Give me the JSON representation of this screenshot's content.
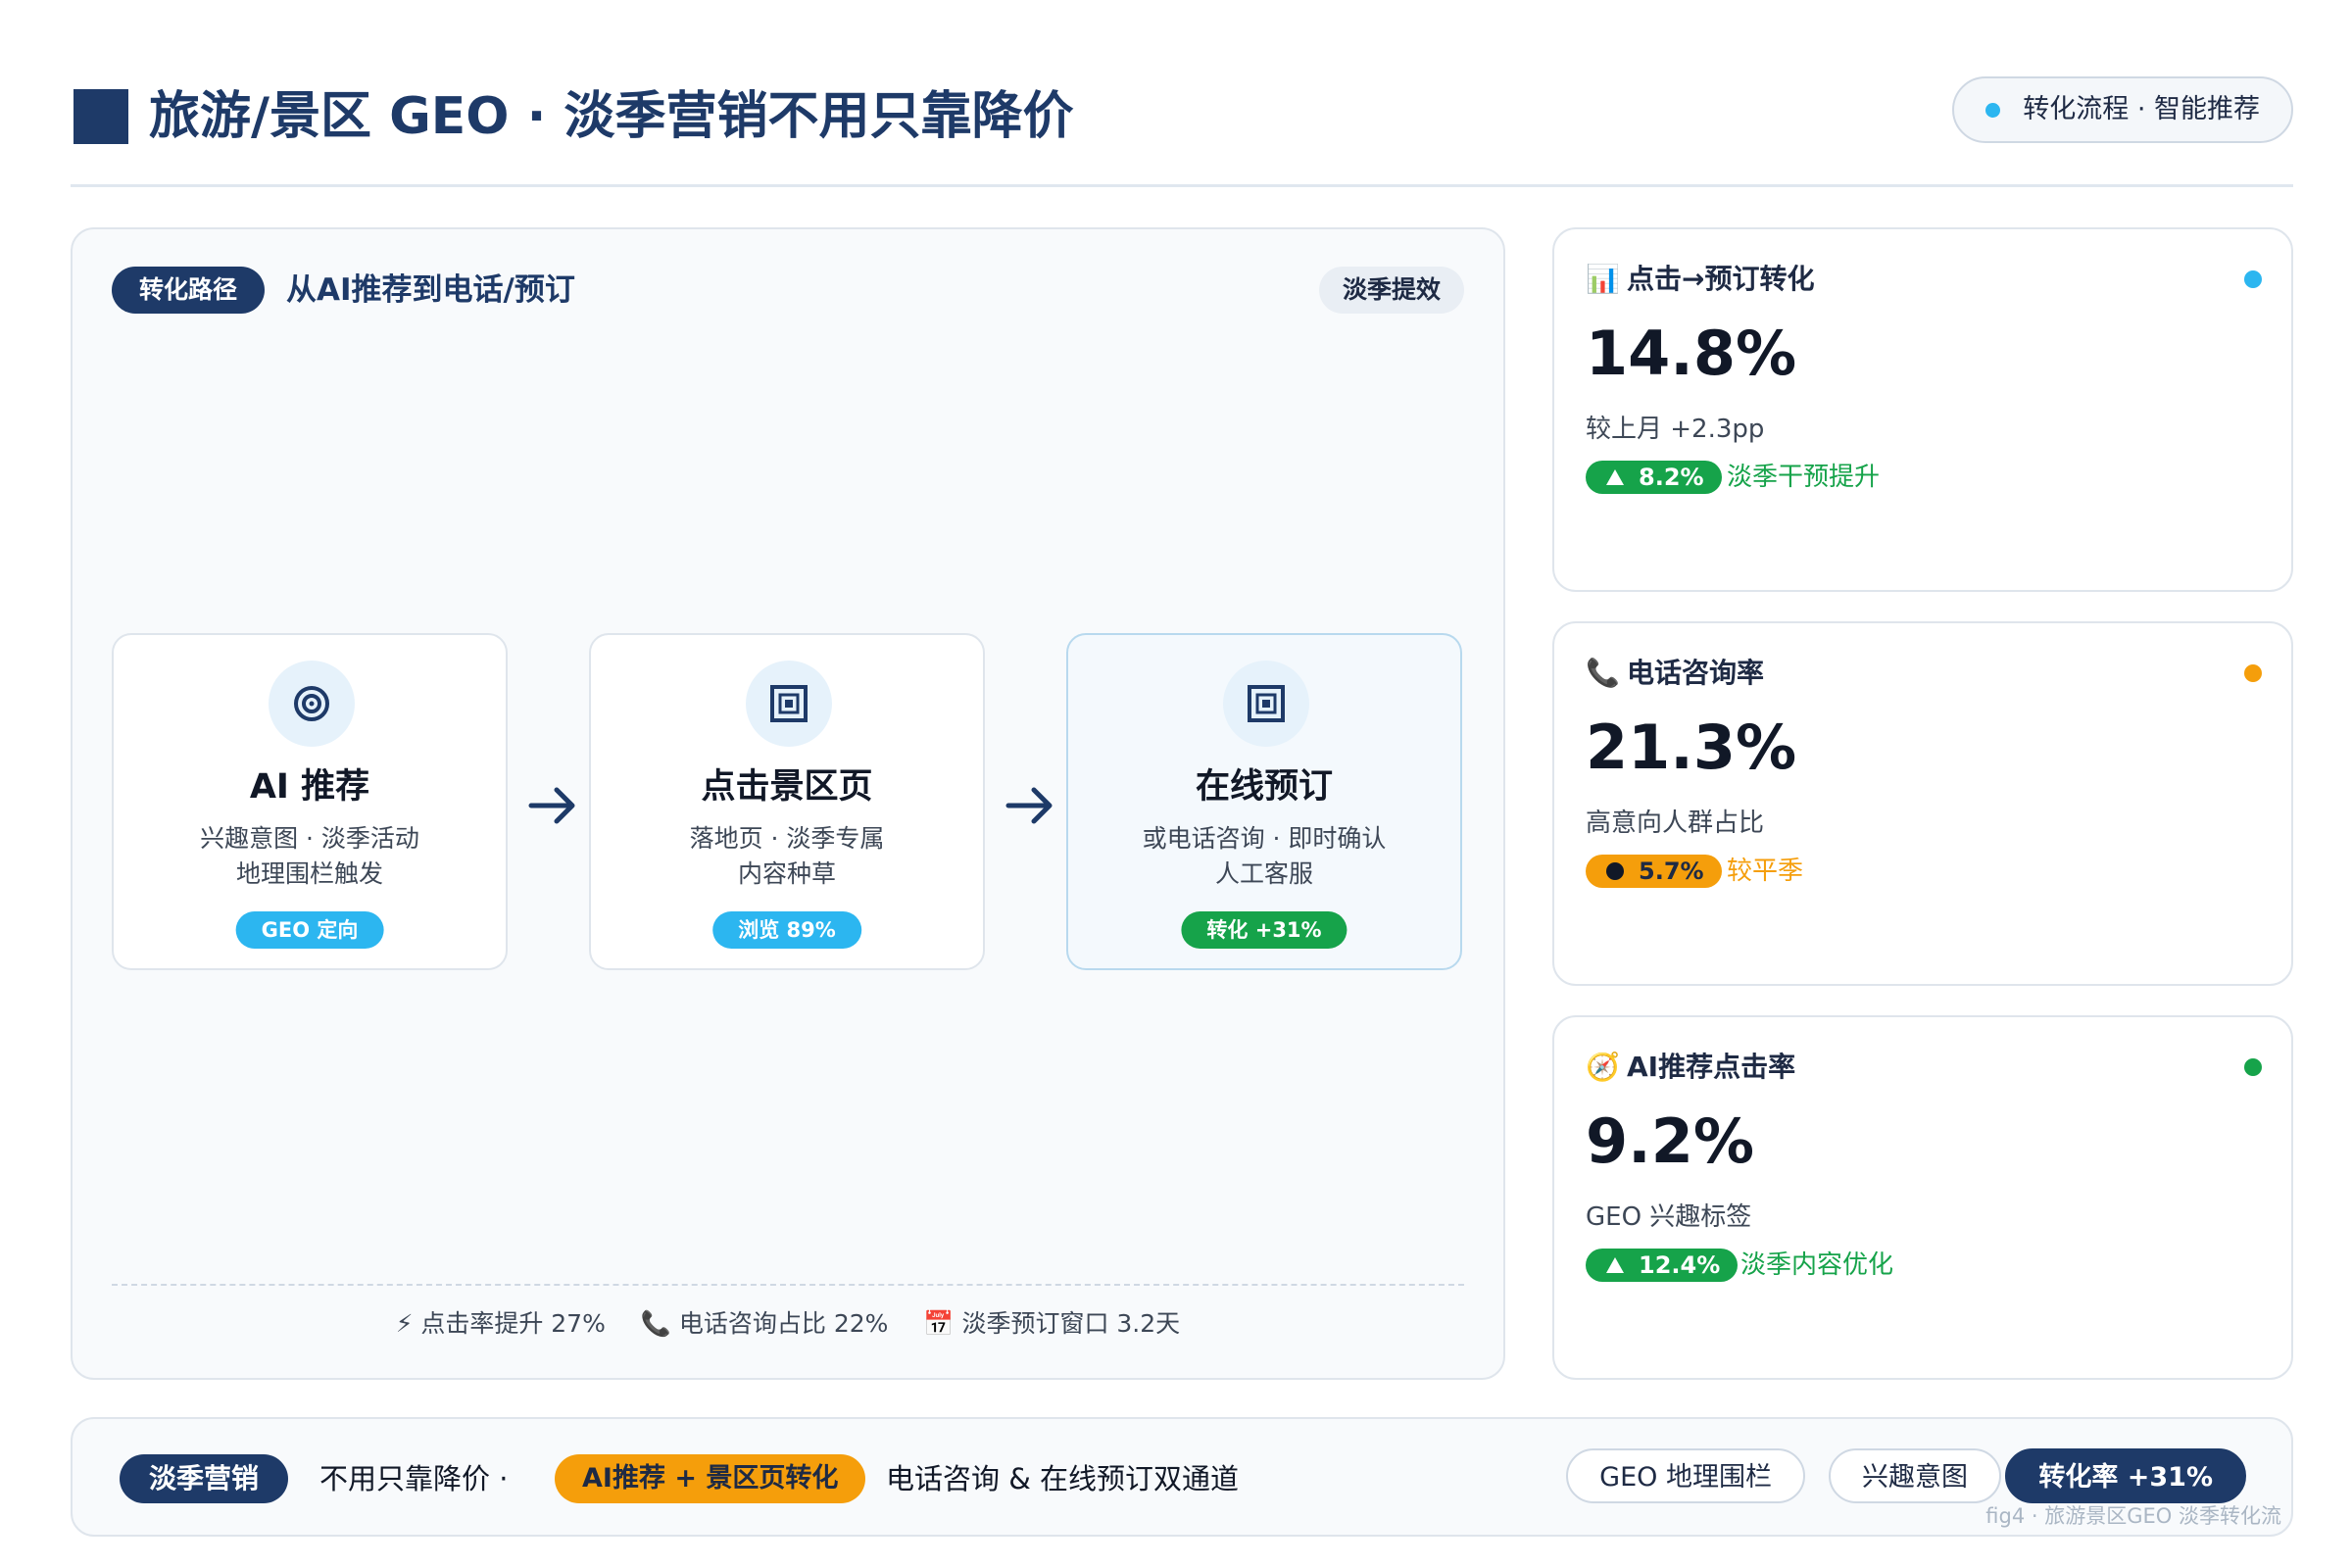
{
  "header": {
    "title": "旅游/景区 GEO · 淡季营销不用只靠降价",
    "pill_text": "转化流程 · 智能推荐"
  },
  "flow": {
    "route_badge": "转化路径",
    "route_title": "从AI推荐到电话/预订",
    "offseason_label": "淡季提效",
    "steps": [
      {
        "title": "AI 推荐",
        "desc1": "兴趣意图 · 淡季活动",
        "desc2": "地理围栏触发",
        "badge": "GEO 定向",
        "icon": "target-icon"
      },
      {
        "title": "点击景区页",
        "desc1": "落地页 · 淡季专属",
        "desc2": "内容种草",
        "badge": "浏览 89%",
        "icon": "page-icon"
      },
      {
        "title": "在线预订",
        "desc1": "或电话咨询 · 即时确认",
        "desc2": "人工客服",
        "badge": "转化 +31%",
        "icon": "booking-icon"
      }
    ],
    "footer": [
      {
        "icon": "⚡",
        "text": "点击率提升 27%"
      },
      {
        "icon": "📞",
        "text": "电话咨询占比 22%"
      },
      {
        "icon": "📅",
        "text": "淡季预订窗口 3.2天"
      }
    ]
  },
  "kpis": [
    {
      "icon": "📊",
      "label": "点击→预订转化",
      "value": "14.8%",
      "sub": "较上月 +2.3pp",
      "chip": "8.2%",
      "chip_glyph": "up-triangle",
      "note": "淡季干预提升",
      "dot_color": "#2cb6f0",
      "chip_color": "#16a34a",
      "note_color": "#16a34a"
    },
    {
      "icon": "📞",
      "label": "电话咨询率",
      "value": "21.3%",
      "sub": "高意向人群占比",
      "chip": "5.7%",
      "chip_glyph": "dot",
      "note": "较平季",
      "dot_color": "#f59e0b",
      "chip_color": "#f59e0b",
      "note_color": "#f59e0b"
    },
    {
      "icon": "🧭",
      "label": "AI推荐点击率",
      "value": "9.2%",
      "sub": "GEO 兴趣标签",
      "chip": "12.4%",
      "chip_glyph": "up-triangle",
      "note": "淡季内容优化",
      "dot_color": "#16a34a",
      "chip_color": "#16a34a",
      "note_color": "#16a34a"
    }
  ],
  "bottom": {
    "badge": "淡季营销",
    "text1": "不用只靠降价 ·",
    "highlight": "AI推荐 + 景区页转化",
    "text2": "电话咨询 & 在线预订双通道",
    "pills": [
      "GEO 地理围栏",
      "兴趣意图",
      "转化率 +31%"
    ],
    "watermark": "fig4 · 旅游景区GEO 淡季转化流"
  },
  "colors": {
    "brand": "#1e3a68",
    "accent_blue": "#2cb6f0",
    "accent_green": "#16a34a",
    "accent_orange": "#f59e0b"
  }
}
